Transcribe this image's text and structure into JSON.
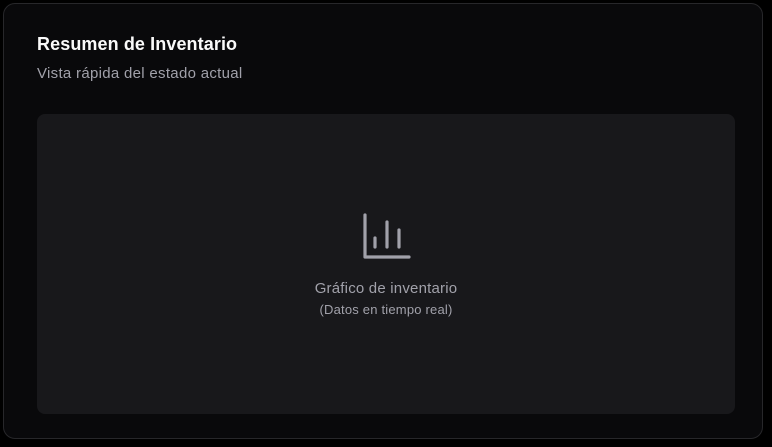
{
  "card": {
    "title": "Resumen de Inventario",
    "subtitle": "Vista rápida del estado actual"
  },
  "placeholder": {
    "icon": "bar-chart-icon",
    "label": "Gráfico de inventario",
    "sublabel": "(Datos en tiempo real)"
  },
  "colors": {
    "background": "#000000",
    "card": "#09090b",
    "card_border": "#27272a",
    "panel": "#18181b",
    "title": "#fafafa",
    "muted": "#a1a1aa"
  }
}
